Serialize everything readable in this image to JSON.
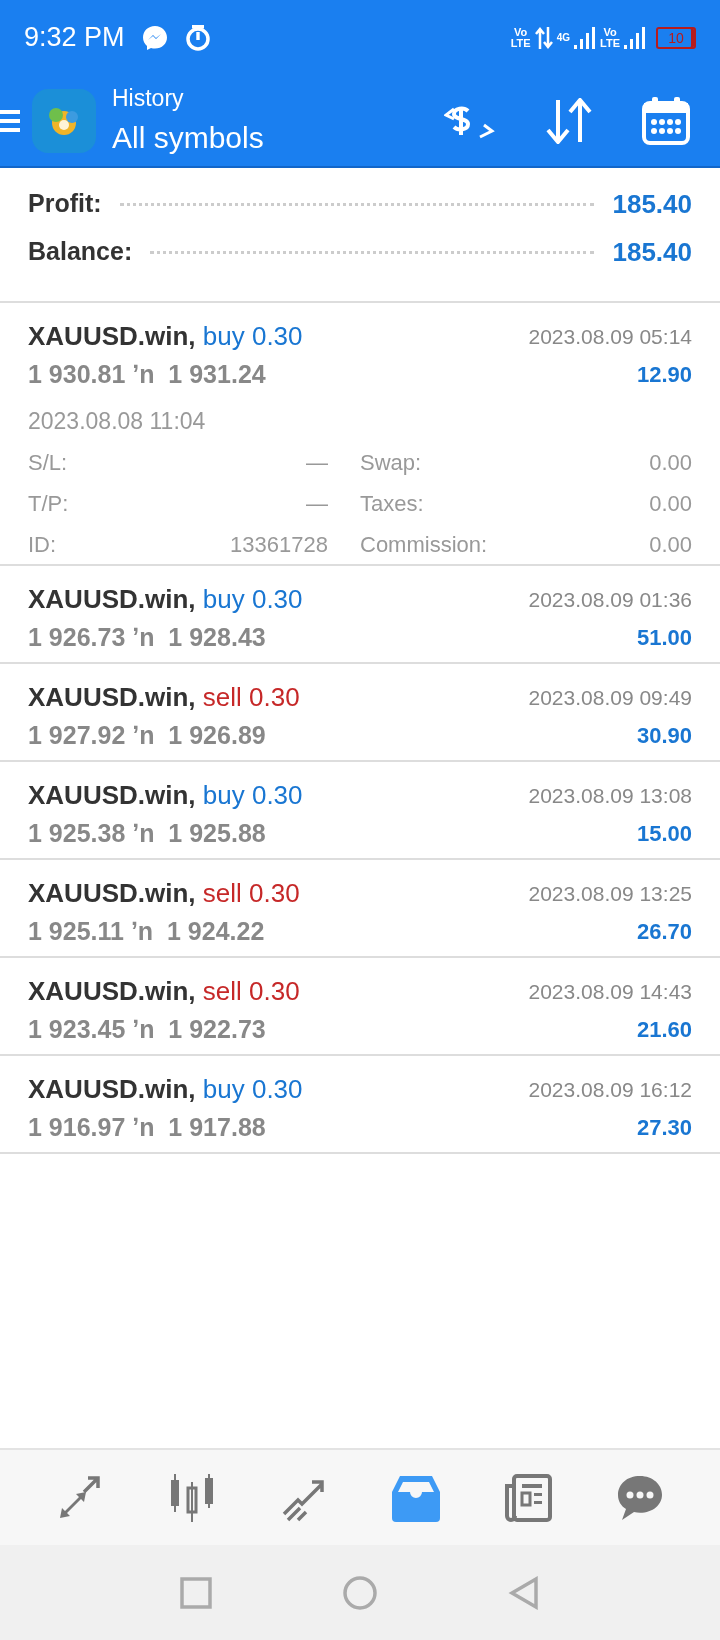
{
  "status_bar": {
    "time": "9:32 PM",
    "sims": [
      {
        "top": "Vo",
        "bottom": "LTE"
      },
      {
        "top": "Vo",
        "bottom": "LTE"
      }
    ],
    "network": "4G",
    "battery": "10"
  },
  "header": {
    "title": "History",
    "subtitle": "All symbols"
  },
  "summary": [
    {
      "label": "Profit:",
      "value": "185.40"
    },
    {
      "label": "Balance:",
      "value": "185.40"
    }
  ],
  "trades": [
    {
      "symbol": "XAUUSD.win,",
      "kind": "buy",
      "side": "buy 0.30",
      "prices": "1 930.81 ʼn  1 931.24",
      "time": "2023.08.09 05:14",
      "profit": "12.90",
      "expanded": true,
      "open_time": "2023.08.08 11:04",
      "details": [
        {
          "label": "S/L:",
          "value": "—",
          "label2": "Swap:",
          "value2": "0.00"
        },
        {
          "label": "T/P:",
          "value": "—",
          "label2": "Taxes:",
          "value2": "0.00"
        },
        {
          "label": "ID:",
          "value": "13361728",
          "label2": "Commission:",
          "value2": "0.00"
        }
      ]
    },
    {
      "symbol": "XAUUSD.win,",
      "kind": "buy",
      "side": "buy 0.30",
      "prices": "1 926.73 ʼn  1 928.43",
      "time": "2023.08.09 01:36",
      "profit": "51.00",
      "expanded": false
    },
    {
      "symbol": "XAUUSD.win,",
      "kind": "sell",
      "side": "sell 0.30",
      "prices": "1 927.92 ʼn  1 926.89",
      "time": "2023.08.09 09:49",
      "profit": "30.90",
      "expanded": false
    },
    {
      "symbol": "XAUUSD.win,",
      "kind": "buy",
      "side": "buy 0.30",
      "prices": "1 925.38 ʼn  1 925.88",
      "time": "2023.08.09 13:08",
      "profit": "15.00",
      "expanded": false
    },
    {
      "symbol": "XAUUSD.win,",
      "kind": "sell",
      "side": "sell 0.30",
      "prices": "1 925.11 ʼn  1 924.22",
      "time": "2023.08.09 13:25",
      "profit": "26.70",
      "expanded": false
    },
    {
      "symbol": "XAUUSD.win,",
      "kind": "sell",
      "side": "sell 0.30",
      "prices": "1 923.45 ʼn  1 922.73",
      "time": "2023.08.09 14:43",
      "profit": "21.60",
      "expanded": false
    },
    {
      "symbol": "XAUUSD.win,",
      "kind": "buy",
      "side": "buy 0.30",
      "prices": "1 916.97 ʼn  1 917.88",
      "time": "2023.08.09 16:12",
      "profit": "27.30",
      "expanded": false
    }
  ],
  "bottom_nav": [
    {
      "kind": "quotes",
      "selected": false
    },
    {
      "kind": "chart",
      "selected": false
    },
    {
      "kind": "trade",
      "selected": false
    },
    {
      "kind": "history",
      "selected": true
    },
    {
      "kind": "news",
      "selected": false
    },
    {
      "kind": "chat",
      "selected": false
    }
  ]
}
